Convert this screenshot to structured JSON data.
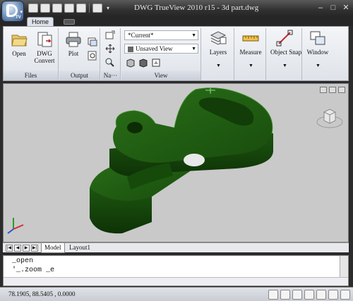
{
  "window": {
    "title": "DWG TrueView 2010    r15 - 3d part.dwg",
    "app_badge": "TV"
  },
  "tabs": [
    {
      "label": "Home"
    }
  ],
  "ribbon": {
    "panels": {
      "files": {
        "label": "Files",
        "open": "Open",
        "dwg_convert": "DWG\nConvert"
      },
      "output": {
        "label": "Output",
        "plot": "Plot"
      },
      "navigate": {
        "label": "Na···"
      },
      "view": {
        "label": "View",
        "view_select": "*Current*",
        "visual_style": "Unsaved View"
      },
      "layers": {
        "label": "Layers"
      },
      "measure": {
        "label": "Measure"
      },
      "object_snap": {
        "label": "Object Snap"
      },
      "window": {
        "label": "Window"
      }
    }
  },
  "layout_tabs": [
    {
      "label": "Model"
    },
    {
      "label": "Layout1"
    }
  ],
  "command": {
    "lines": [
      "_open",
      "'_.zoom _e"
    ]
  },
  "status": {
    "coordinates": "78.1905, 88.5405 , 0.0000"
  },
  "colors": {
    "part_fill": "#1f5a12",
    "part_dark": "#0f3a08",
    "part_light": "#2f7a1f",
    "viewport_bg": "#c9c9c9"
  }
}
